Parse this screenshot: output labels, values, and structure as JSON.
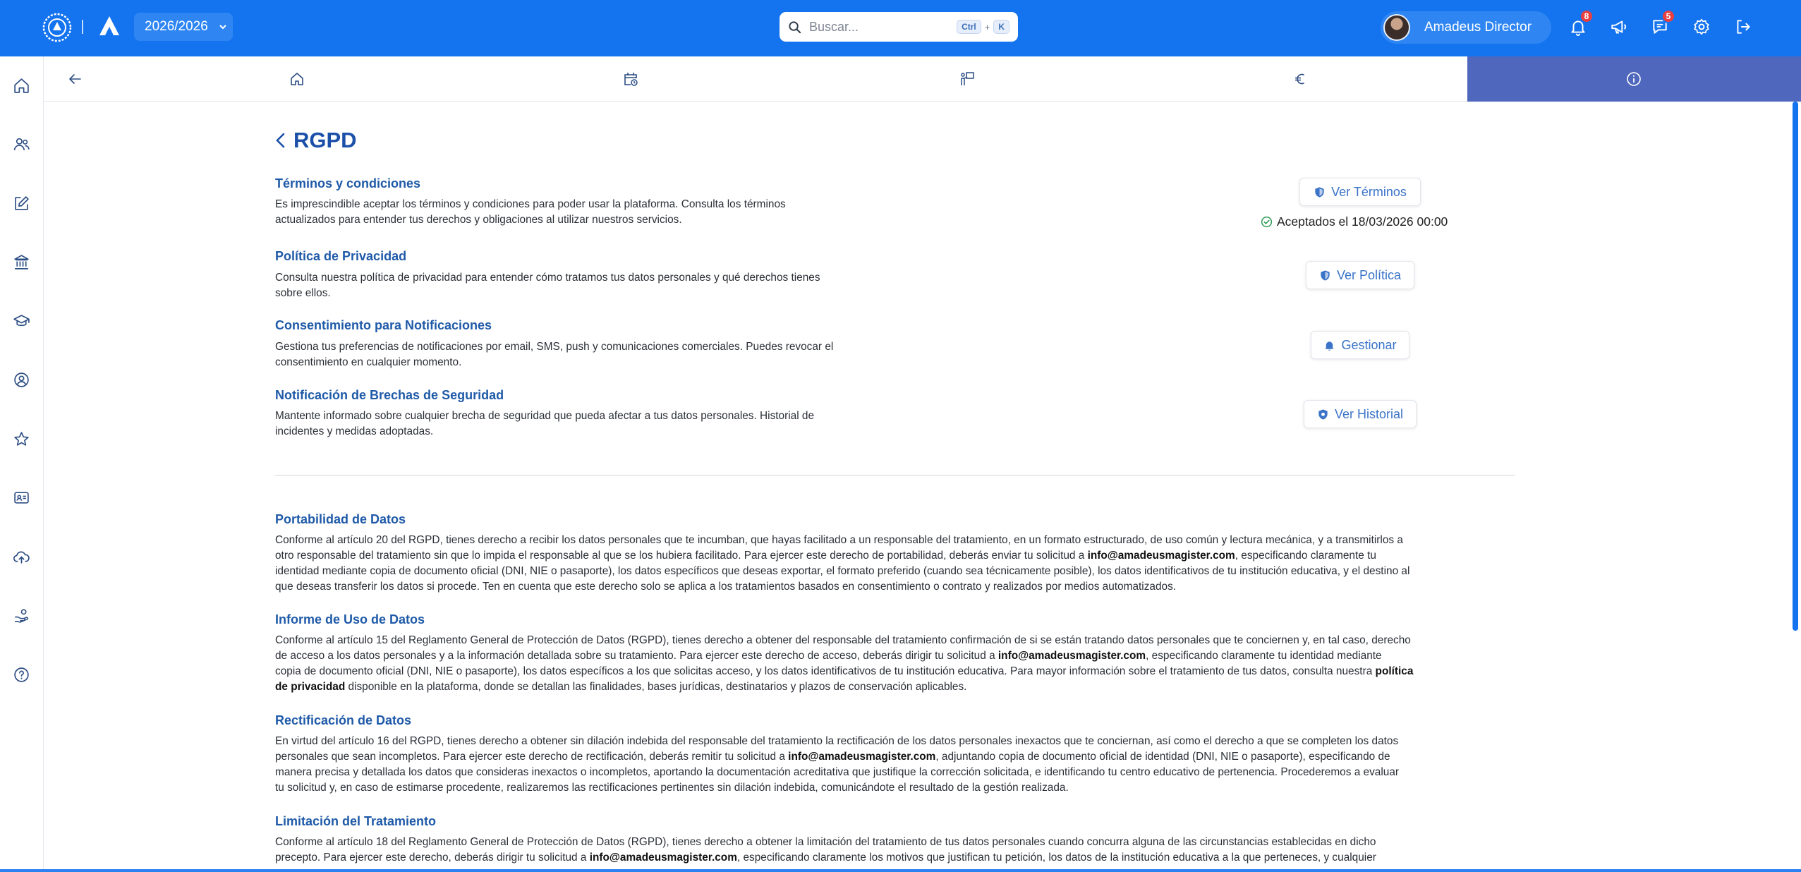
{
  "topbar": {
    "year": "2026/2026",
    "search_placeholder": "Buscar...",
    "kbd_ctrl": "Ctrl",
    "kbd_plus": "+",
    "kbd_k": "K",
    "user_name": "Amadeus Director",
    "notifications_count": "8",
    "messages_count": "5",
    "brand_color": "#1473ee"
  },
  "page": {
    "title": "RGPD"
  },
  "sections": [
    {
      "title": "Términos y condiciones",
      "lines": [
        "Es imprescindible aceptar los términos y condiciones para poder usar la plataforma. Consulta los términos",
        "actualizados para entender tus derechos y obligaciones al utilizar nuestros servicios."
      ],
      "button": "Ver Términos",
      "accepted": "Aceptados el 18/03/2026 00:00"
    },
    {
      "title": "Política de Privacidad",
      "lines": [
        "Consulta nuestra política de privacidad para entender cómo tratamos tus datos personales y qué derechos tienes",
        "sobre ellos."
      ],
      "button": "Ver Política"
    },
    {
      "title": "Consentimiento para Notificaciones",
      "lines": [
        "Gestiona tus preferencias de notificaciones por email, SMS, push y comunicaciones comerciales. Puedes revocar el",
        "consentimiento en cualquier momento."
      ],
      "button": "Gestionar"
    },
    {
      "title": "Notificación de Brechas de Seguridad",
      "lines": [
        "Mantente informado sobre cualquier brecha de seguridad que pueda afectar a tus datos personales. Historial de",
        "incidentes y medidas adoptadas."
      ],
      "button": "Ver Historial"
    }
  ],
  "rights": [
    {
      "title": "Portabilidad de Datos",
      "l1": "Conforme al artículo 20 del RGPD, tienes derecho a recibir los datos personales que te incumban, que hayas facilitado a un responsable del tratamiento, en un formato estructurado, de uso común y lectura mecánica, y a transmitirlos a",
      "l2a": "otro responsable del tratamiento sin que lo impida el responsable al que se los hubiera facilitado. Para ejercer este derecho de portabilidad, deberás enviar tu solicitud a ",
      "email": "info@amadeusmagister.com",
      "l2b": ", especificando claramente tu",
      "l3": "identidad mediante copia de documento oficial (DNI, NIE o pasaporte), los datos específicos que deseas exportar, el formato preferido (cuando sea técnicamente posible), los datos identificativos de tu institución educativa, y el destino al",
      "l4": "que deseas transferir los datos si procede. Ten en cuenta que este derecho solo se aplica a los tratamientos basados en consentimiento o contrato y realizados por medios automatizados."
    },
    {
      "title": "Informe de Uso de Datos",
      "l1": "Conforme al artículo 15 del Reglamento General de Protección de Datos (RGPD), tienes derecho a obtener del responsable del tratamiento confirmación de si se están tratando datos personales que te conciernen y, en tal caso, derecho",
      "l2a": "de acceso a los datos personales y a la información detallada sobre su tratamiento. Para ejercer este derecho de acceso, deberás dirigir tu solicitud a ",
      "email": "info@amadeusmagister.com",
      "l2b": ", especificando claramente tu identidad mediante",
      "l3a": "copia de documento oficial (DNI, NIE o pasaporte), los datos específicos a los que solicitas acceso, y los datos identificativos de tu institución educativa. Para mayor información sobre el tratamiento de tus datos, consulta nuestra ",
      "l3b": "política",
      "l4a": "de privacidad",
      "l4b": " disponible en la plataforma, donde se detallan las finalidades, bases jurídicas, destinatarios y plazos de conservación aplicables."
    },
    {
      "title": "Rectificación de Datos",
      "l1": "En virtud del artículo 16 del RGPD, tienes derecho a obtener sin dilación indebida del responsable del tratamiento la rectificación de los datos personales inexactos que te conciernan, así como el derecho a que se completen los datos",
      "l2a": "personales que sean incompletos. Para ejercer este derecho de rectificación, deberás remitir tu solicitud a ",
      "email": "info@amadeusmagister.com",
      "l2b": ", adjuntando copia de documento oficial de identidad (DNI, NIE o pasaporte), especificando de",
      "l3": "manera precisa y detallada los datos que consideras inexactos o incompletos, aportando la documentación acreditativa que justifique la corrección solicitada, e identificando tu centro educativo de pertenencia. Procederemos a evaluar",
      "l4": "tu solicitud y, en caso de estimarse procedente, realizaremos las rectificaciones pertinentes sin dilación indebida, comunicándote el resultado de la gestión realizada."
    },
    {
      "title": "Limitación del Tratamiento",
      "l1": "Conforme al artículo 18 del Reglamento General de Protección de Datos (RGPD), tienes derecho a obtener la limitación del tratamiento de tus datos personales cuando concurra alguna de las circunstancias establecidas en dicho",
      "l2a": "precepto. Para ejercer este derecho, deberás dirigir tu solicitud a ",
      "email": "info@amadeusmagister.com",
      "l2b": ", especificando claramente los motivos que justifican tu petición, los datos de la institución educativa a la que perteneces, y cualquier"
    }
  ]
}
